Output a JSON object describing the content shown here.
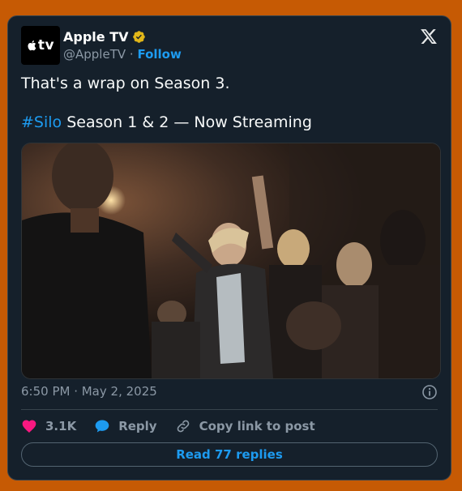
{
  "account": {
    "display_name": "Apple TV",
    "handle": "@AppleTV",
    "separator": " · ",
    "follow_label": "Follow",
    "avatar_text": "tv"
  },
  "tweet": {
    "line1": "That's a wrap on Season 3.",
    "hashtag": "#Silo",
    "line2_rest": " Season 1 & 2 — Now Streaming",
    "timestamp": "6:50 PM · May 2, 2025"
  },
  "actions": {
    "like_count": "3.1K",
    "reply_label": "Reply",
    "copy_label": "Copy link to post"
  },
  "read_replies_label": "Read 77 replies",
  "colors": {
    "background": "#c65a04",
    "card": "#15202b",
    "accent": "#1d9bf0",
    "like": "#f91880",
    "verified": "#e2b719"
  },
  "icons": [
    "apple-logo-icon",
    "verified-badge-icon",
    "x-logo-icon",
    "info-icon",
    "heart-icon",
    "speech-bubble-icon",
    "link-icon"
  ]
}
